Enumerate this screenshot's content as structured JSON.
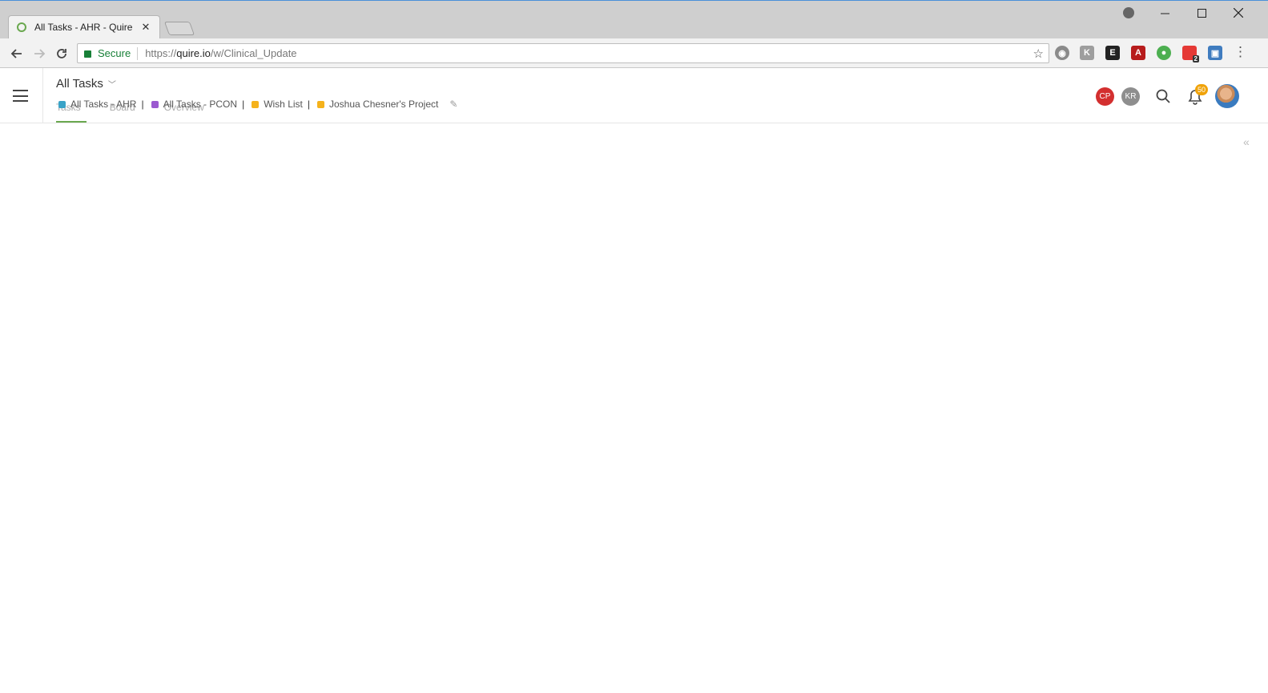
{
  "browser": {
    "tab_title": "All Tasks - AHR - Quire",
    "tab_close": "✕",
    "url_secure": "Secure",
    "url_scheme": "https://",
    "url_host": "quire.io",
    "url_path": "/w/Clinical_Update",
    "ext_badge": "2"
  },
  "app": {
    "project_title": "All Tasks",
    "view_tabs": [
      "Tasks",
      "Board",
      "Overview"
    ],
    "crumbs": [
      {
        "label": "All Tasks - AHR",
        "color": "#3aa3c7"
      },
      {
        "label": "All Tasks - PCON",
        "color": "#9b59d0"
      },
      {
        "label": "Wish List",
        "color": "#f5b21b"
      },
      {
        "label": "Joshua Chesner's Project",
        "color": "#f5b21b"
      }
    ],
    "members": [
      {
        "initials": "CP",
        "color": "#d32f2f"
      },
      {
        "initials": "KR",
        "color": "#8e8e8e"
      }
    ],
    "notification_count": "50",
    "collapse_glyph": "«"
  },
  "colors": {
    "accent": "#6aa84f",
    "secure": "#188038",
    "badge": "#f0a30a"
  }
}
